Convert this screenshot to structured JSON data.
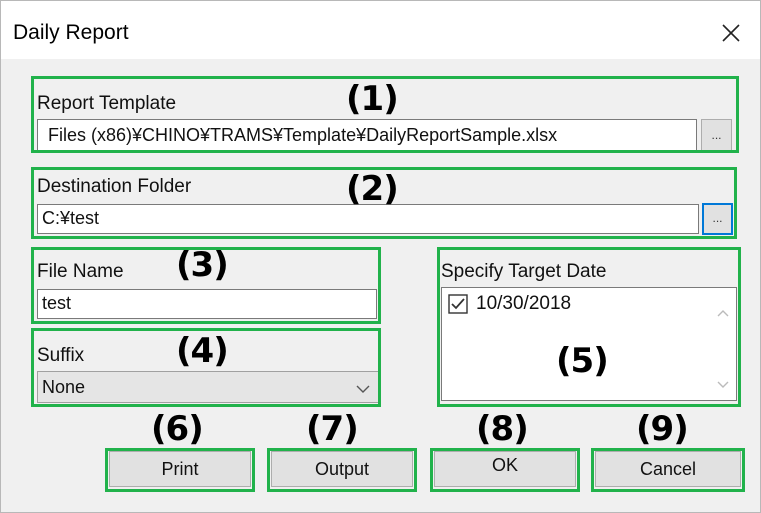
{
  "window": {
    "title": "Daily Report"
  },
  "report_template": {
    "label": "Report Template",
    "path": "Files (x86)¥CHINO¥TRAMS¥Template¥DailyReportSample.xlsx",
    "browse_label": "..."
  },
  "destination_folder": {
    "label": "Destination Folder",
    "path": "C:¥test",
    "browse_label": "..."
  },
  "file_name": {
    "label": "File Name",
    "value": "test"
  },
  "suffix": {
    "label": "Suffix",
    "selected": "None"
  },
  "target_date": {
    "label": "Specify Target Date",
    "items": [
      {
        "checked": true,
        "date": "10/30/2018"
      }
    ]
  },
  "buttons": {
    "print": "Print",
    "output": "Output",
    "ok": "OK",
    "cancel": "Cancel"
  },
  "callouts": [
    "(1)",
    "(2)",
    "(3)",
    "(4)",
    "(5)",
    "(6)",
    "(7)",
    "(8)",
    "(9)"
  ],
  "colors": {
    "callout_border": "#21b24b",
    "focus_border": "#0078d7",
    "dialog_bg": "#f0f0f0"
  },
  "icons": {
    "close": "close-icon",
    "dropdown": "chevron-down-icon",
    "checkbox": "checkbox-checked-icon",
    "scroll_up": "scroll-up-arrow-icon",
    "scroll_down": "scroll-down-arrow-icon"
  }
}
